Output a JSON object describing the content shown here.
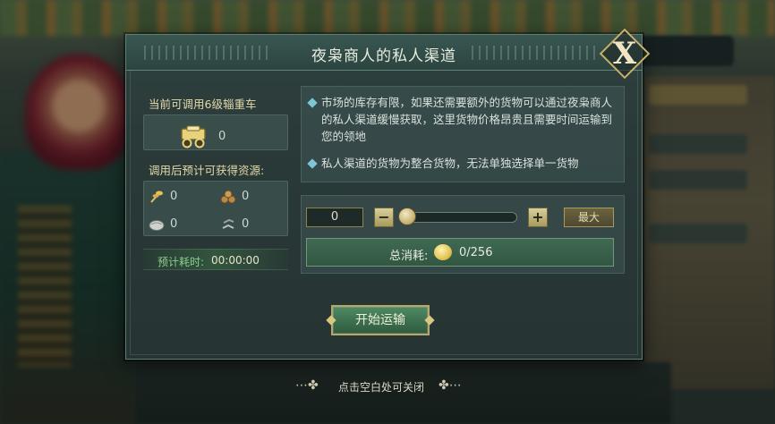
{
  "dialog": {
    "title": "夜枭商人的私人渠道",
    "close_label": "X"
  },
  "left": {
    "available_label": "当前可调用6级辎重车",
    "cart_count": "0",
    "expect_label": "调用后预计可获得资源:",
    "resources": [
      {
        "icon": "wheat-icon",
        "value": "0"
      },
      {
        "icon": "wood-logs-icon",
        "value": "0"
      },
      {
        "icon": "stone-icon",
        "value": "0"
      },
      {
        "icon": "iron-icon",
        "value": "0"
      }
    ],
    "time_label": "预计耗时:",
    "time_value": "00:00:00"
  },
  "info": {
    "line1": "市场的库存有限，如果还需要额外的货物可以通过夜枭商人的私人渠道缓慢获取，这里货物价格昂贵且需要时间运输到您的领地",
    "line2": "私人渠道的货物为整合货物，无法单独选择单一货物"
  },
  "controls": {
    "quantity": "0",
    "minus": "−",
    "plus": "+",
    "max_label": "最大",
    "slider_fraction": 0
  },
  "cost": {
    "label": "总消耗:",
    "value": "0/256"
  },
  "start_label": "开始运输",
  "hint": "点击空白处可关闭",
  "colors": {
    "panel": "#2a3a39",
    "accent_gold": "#c9b16a",
    "button_green": "#3a6d4d",
    "bullet": "#7ec6d6"
  }
}
